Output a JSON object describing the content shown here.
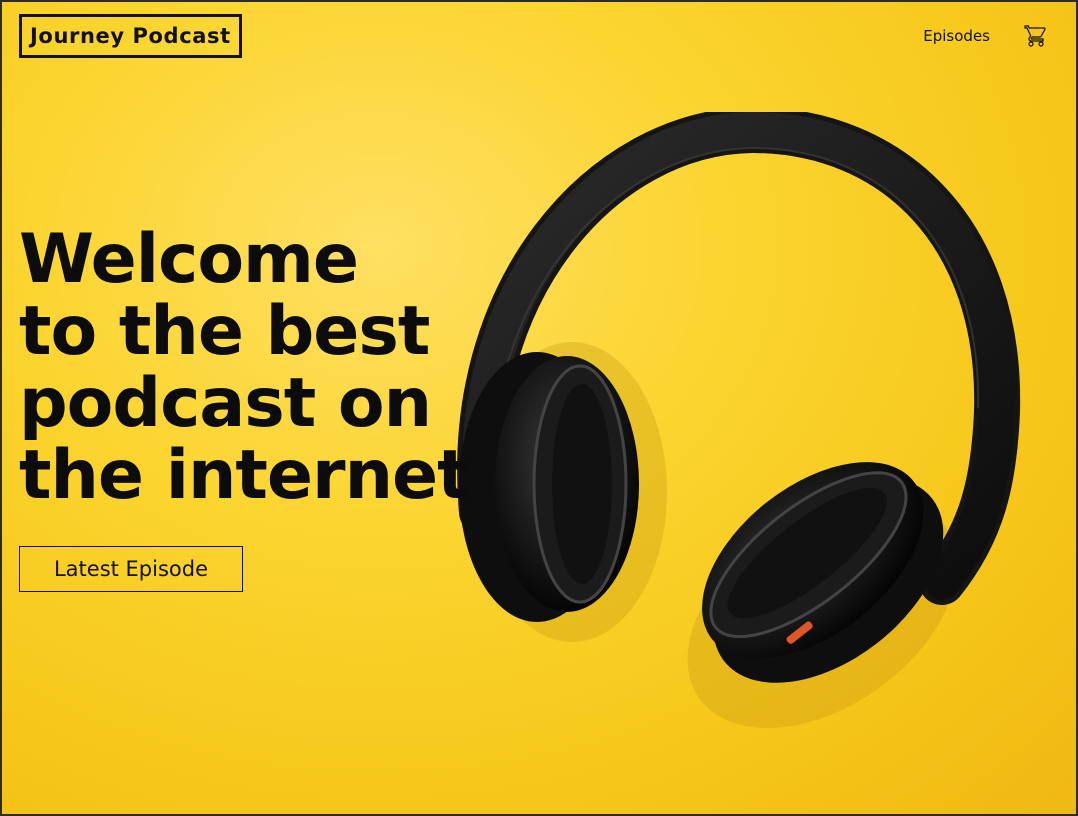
{
  "header": {
    "logo": "Journey Podcast",
    "nav": [
      {
        "label": "Episodes"
      }
    ],
    "cart_icon": "cart-icon"
  },
  "hero": {
    "title_lines": [
      "Welcome",
      "to the best",
      "podcast on",
      "the internet"
    ],
    "cta_label": "Latest Episode",
    "image": "headphones-image"
  },
  "colors": {
    "background": "#f8cd23",
    "text": "#111111"
  }
}
